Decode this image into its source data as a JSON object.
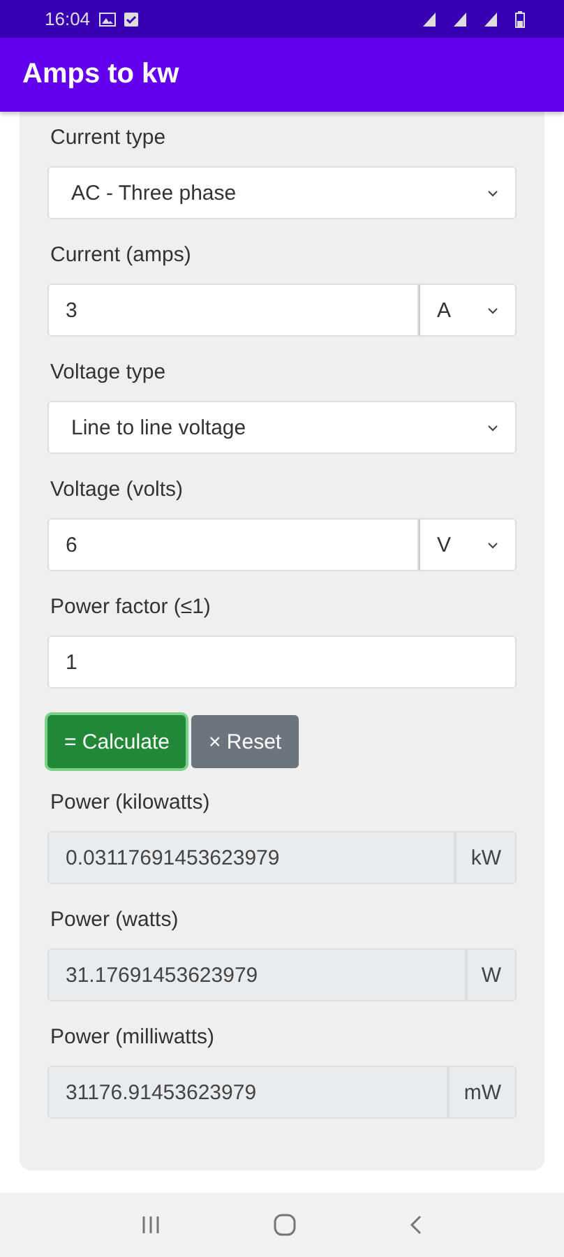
{
  "status_bar": {
    "time": "16:04"
  },
  "app_bar": {
    "title": "Amps to kw"
  },
  "form": {
    "fields": [
      {
        "kind": "select",
        "label": "Current type",
        "value": "AC - Three phase"
      },
      {
        "kind": "input_unit",
        "label": "Current (amps)",
        "value": "3",
        "unit": "A"
      },
      {
        "kind": "select",
        "label": "Voltage type",
        "value": "Line to line voltage"
      },
      {
        "kind": "input_unit",
        "label": "Voltage (volts)",
        "value": "6",
        "unit": "V"
      },
      {
        "kind": "input",
        "label": "Power factor (≤1)",
        "value": "1"
      }
    ],
    "buttons": [
      {
        "kind": "primary",
        "label": "= Calculate"
      },
      {
        "kind": "secondary",
        "label": "× Reset"
      }
    ],
    "results": [
      {
        "label": "Power (kilowatts)",
        "value": "0.03117691453623979",
        "unit": "kW"
      },
      {
        "label": "Power (watts)",
        "value": "31.17691453623979",
        "unit": "W"
      },
      {
        "label": "Power (milliwatts)",
        "value": "31176.91453623979",
        "unit": "mW"
      }
    ]
  }
}
